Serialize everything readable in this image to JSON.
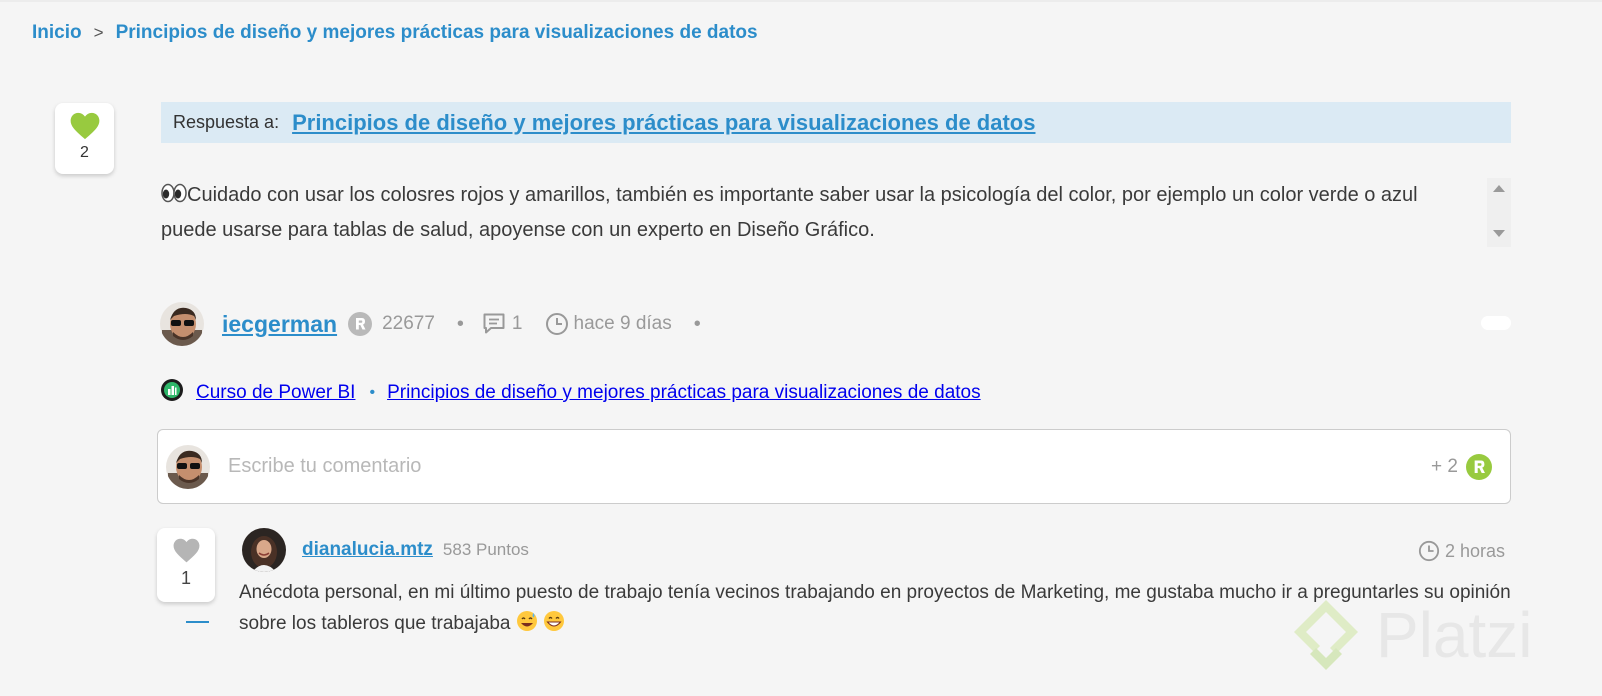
{
  "breadcrumb": {
    "home": "Inicio",
    "separator": ">",
    "current": "Principios de diseño y mejores prácticas para visualizaciones de datos"
  },
  "post": {
    "likes": "2",
    "reply_to_label": "Respuesta a:",
    "reply_to_title": "Principios de diseño y mejores prácticas para visualizaciones de datos",
    "body": "Cuidado con usar los colosres rojos y amarillos, también es importante saber usar la psicología del color, por ejemplo un color verde o azul puede usarse para tablas de salud, apoyense con un experto en Diseño Gráfico.",
    "author": "iecgerman",
    "points": "22677",
    "comments": "1",
    "time": "hace 9 días",
    "bullet": "•",
    "course": "Curso de Power BI",
    "class_title": "Principios de diseño y mejores prácticas para visualizaciones de datos"
  },
  "comment_box": {
    "placeholder": "Escribe tu comentario",
    "bonus": "+ 2"
  },
  "reply": {
    "likes": "1",
    "author": "dianalucia.mtz",
    "points": "583 Puntos",
    "time": "2 horas",
    "text": "Anécdota personal, en mi último puesto de trabajo tenía vecinos trabajando en proyectos de Marketing, me gustaba mucho ir a preguntarles su opinión sobre los tableros que trabajaba"
  },
  "watermark": "Platzi",
  "colors": {
    "link": "#2c8dca",
    "like_active": "#98ca3f",
    "like_inactive": "#b5b5b5",
    "reply_header_bg": "#dbeaf4",
    "background": "#f5f5f5"
  },
  "icons": [
    "heart-icon",
    "eyes-emoji-icon",
    "rank-badge-icon",
    "comment-icon",
    "clock-icon",
    "course-badge-icon",
    "smiling-sweat-emoji-icon",
    "grinning-emoji-icon",
    "platzi-logo-icon"
  ]
}
